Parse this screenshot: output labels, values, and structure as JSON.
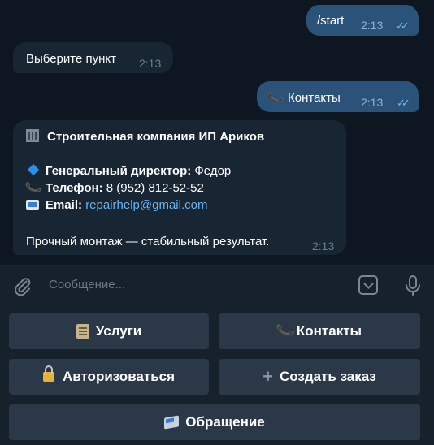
{
  "messages": [
    {
      "id": "m1",
      "direction": "outgoing",
      "text": "/start",
      "time": "2:13",
      "status": "read"
    },
    {
      "id": "m2",
      "direction": "incoming",
      "text": "Выберите пункт",
      "time": "2:13"
    },
    {
      "id": "m3",
      "direction": "outgoing",
      "text": "Контакты",
      "icon": "phone-icon",
      "time": "2:13",
      "status": "read"
    },
    {
      "id": "m4",
      "direction": "incoming",
      "time": "2:13",
      "company": "Строительная компания ИП Ариков",
      "director_label": "Генеральный директор:",
      "director_value": "Федор",
      "phone_label": "Телефон:",
      "phone_value": "8 (952) 812-52-52",
      "email_label": "Email:",
      "email_value": "repairhelp@gmail.com",
      "footer": "Прочный монтаж — стабильный результат."
    }
  ],
  "composer": {
    "placeholder": "Сообщение..."
  },
  "keyboard": {
    "buttons": [
      {
        "label": "Услуги",
        "icon": "clipboard-icon"
      },
      {
        "label": "Контакты",
        "icon": "phone-icon"
      },
      {
        "label": "Авторизоваться",
        "icon": "lock-key-icon"
      },
      {
        "label": "Создать заказ",
        "icon": "plus-icon"
      },
      {
        "label": "Обращение",
        "icon": "inbox-tray-icon"
      }
    ]
  },
  "colors": {
    "background": "#0e1621",
    "outgoing_bubble": "#2b5278",
    "incoming_bubble": "#182533",
    "link": "#6ab3f3",
    "keyboard_button": "#2b3848",
    "panel": "#17212b"
  }
}
